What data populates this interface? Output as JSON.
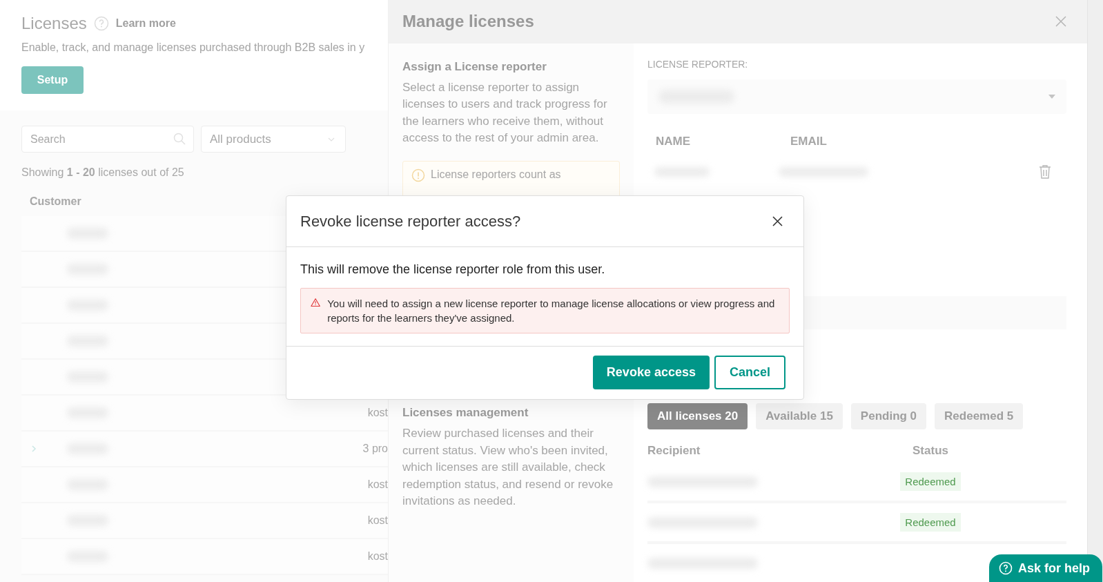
{
  "page": {
    "title": "Licenses",
    "learn_more": "Learn more",
    "subtitle": "Enable, track, and manage licenses purchased through B2B sales in y",
    "setup_button": "Setup",
    "search": {
      "placeholder": "Search"
    },
    "product_filter": {
      "value": "All products"
    },
    "showing": "Showing **1 - 20** licenses out of 25",
    "table": {
      "columns": [
        "Customer"
      ],
      "rows": [
        {
          "expandable": false
        },
        {
          "expandable": false
        },
        {
          "expandable": false
        },
        {
          "expandable": false
        },
        {
          "expandable": false
        },
        {
          "expandable": false,
          "column_2": "kost"
        },
        {
          "expandable": true,
          "column_2": "3 pro"
        },
        {
          "expandable": false,
          "column_2": "kost"
        },
        {
          "expandable": false,
          "column_2": "kost"
        },
        {
          "expandable": false,
          "column_2": "kost"
        }
      ]
    }
  },
  "panel": {
    "title": "Manage licenses",
    "reporter_section": {
      "heading": "Assign a License reporter",
      "description": "Select a license reporter to assign licenses to users and track progress for the learners who receive them, without access to the rest of your admin area.",
      "notice": "License reporters count as",
      "field_label": "LICENSE REPORTER:",
      "columns": [
        "NAME",
        "EMAIL"
      ]
    },
    "management_section": {
      "heading": "Licenses management",
      "description": "Review purchased licenses and their current status. View who's been invited, which licenses are still available, check redemption status, and resend or revoke invitations as needed.",
      "tabs": [
        {
          "label": "All licenses 20",
          "selected": true
        },
        {
          "label": "Available 15",
          "selected": false
        },
        {
          "label": "Pending 0",
          "selected": false
        },
        {
          "label": "Redeemed 5",
          "selected": false
        }
      ],
      "columns": [
        "Recipient",
        "Status"
      ],
      "rows": [
        {
          "status": "Redeemed"
        },
        {
          "status": "Redeemed"
        }
      ]
    }
  },
  "dialog": {
    "title": "Revoke license reporter access?",
    "message": "This will remove the license reporter role from this user.",
    "warning": "You will need to assign a new license reporter to manage license allocations or view progress and reports for the learners they've assigned.",
    "buttons": [
      {
        "label": "Revoke access",
        "kind": "primary"
      },
      {
        "label": "Cancel",
        "kind": "secondary"
      }
    ]
  },
  "help_button": "Ask for help"
}
